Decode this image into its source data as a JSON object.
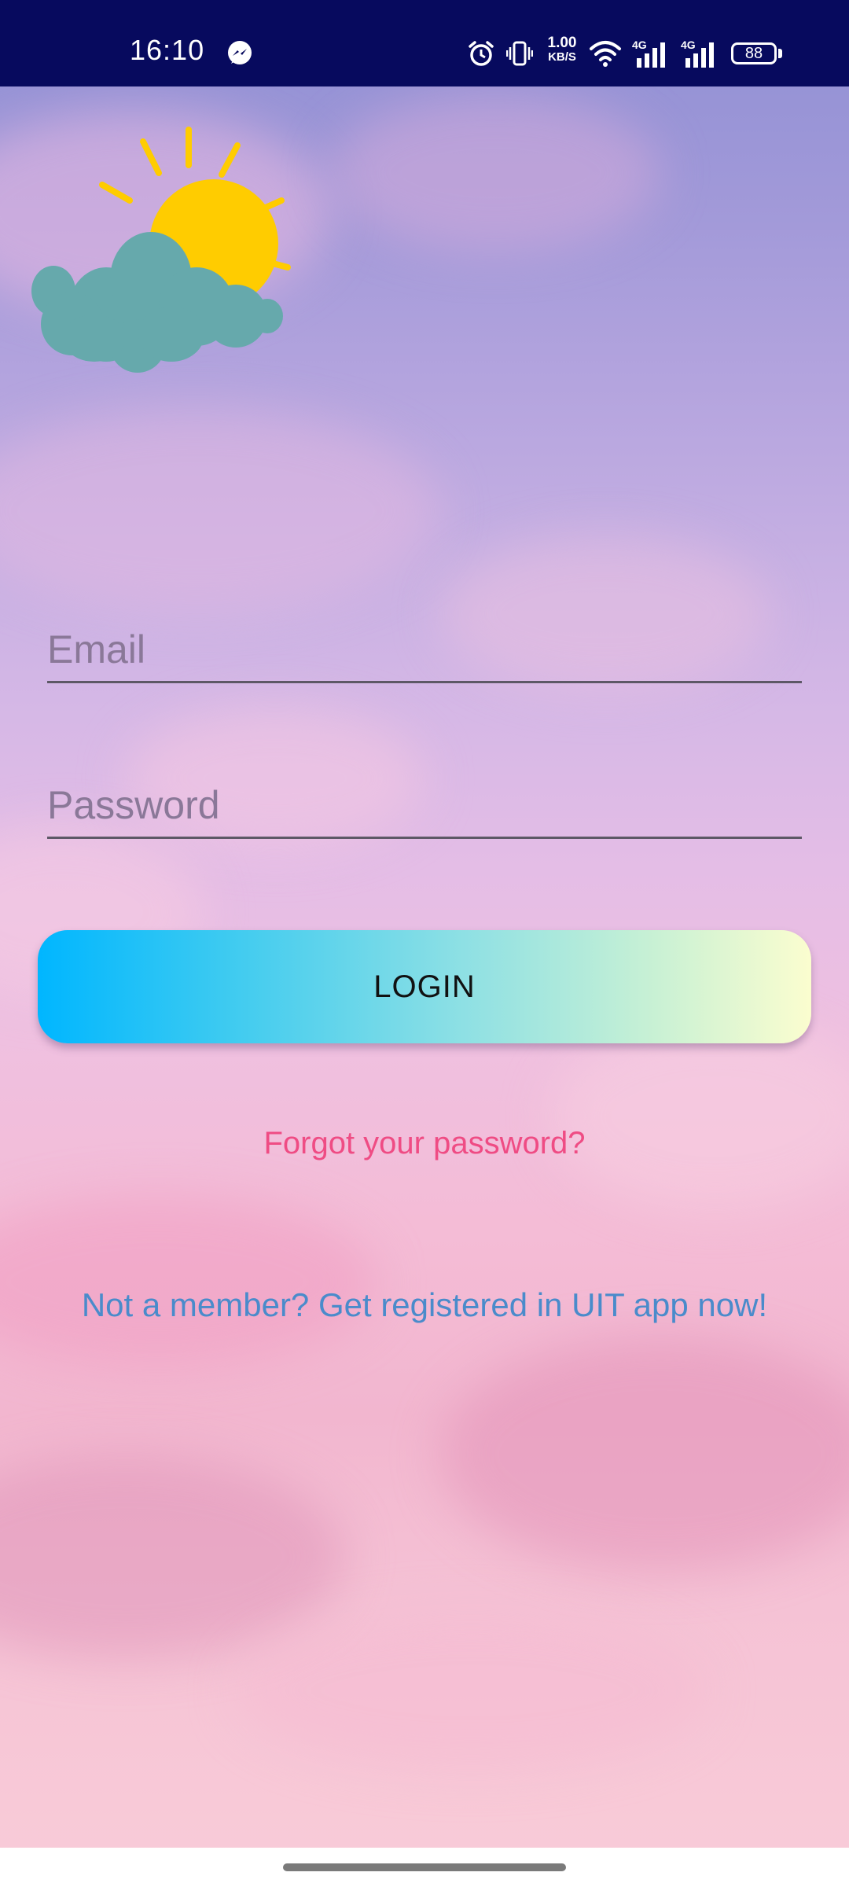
{
  "status_bar": {
    "time": "16:10",
    "net_speed_value": "1.00",
    "net_speed_unit": "KB/S",
    "network_1": "4G",
    "network_2": "4G",
    "battery": "88",
    "icons": [
      "messenger-icon",
      "alarm-icon",
      "vibrate-icon",
      "wifi-icon",
      "signal-icon",
      "signal-icon",
      "battery-icon"
    ]
  },
  "logo": {
    "icon": "sun-behind-cloud-icon",
    "colors": {
      "sun": "#ffcc00",
      "cloud": "#66a9ac"
    }
  },
  "form": {
    "email_placeholder": "Email",
    "email_value": "",
    "password_placeholder": "Password",
    "password_value": ""
  },
  "actions": {
    "login_label": "LOGIN",
    "forgot_label": "Forgot your password?",
    "register_label": "Not a member? Get registered in UIT app now!"
  },
  "colors": {
    "status_bar": "#070a5e",
    "forgot_link": "#ef4c84",
    "register_link": "#4a8bcb",
    "button_gradient_start": "#00b6ff",
    "button_gradient_end": "#fbfdcf"
  }
}
